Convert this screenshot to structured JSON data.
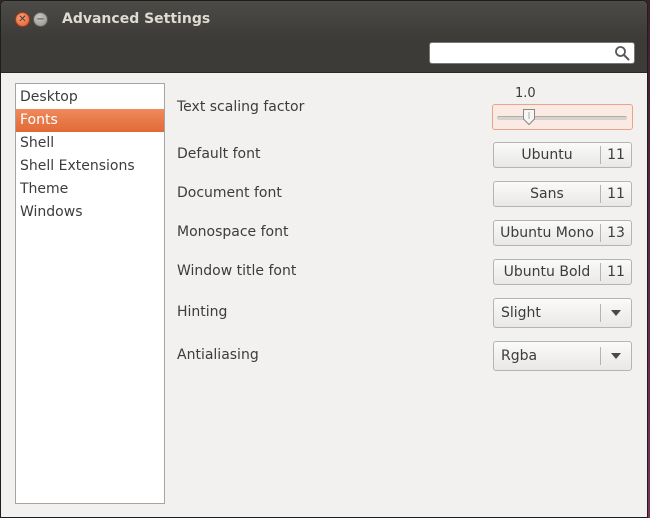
{
  "window": {
    "title": "Advanced Settings"
  },
  "icons": {
    "close": "close-icon",
    "minimize": "minimize-icon",
    "search": "search-icon",
    "dropdown": "chevron-down-icon"
  },
  "colors": {
    "accent": "#e06a36",
    "titlebar": "#3c3b37",
    "background": "#f2f1f0"
  },
  "search": {
    "value": "",
    "placeholder": ""
  },
  "sidebar": {
    "selected": "Fonts",
    "items": [
      {
        "label": "Desktop"
      },
      {
        "label": "Fonts"
      },
      {
        "label": "Shell"
      },
      {
        "label": "Shell Extensions"
      },
      {
        "label": "Theme"
      },
      {
        "label": "Windows"
      }
    ]
  },
  "settings": {
    "text_scaling": {
      "label": "Text scaling factor",
      "value": "1.0",
      "slider_fraction": 0.2
    },
    "default_font": {
      "label": "Default font",
      "font": "Ubuntu",
      "size": "11"
    },
    "document_font": {
      "label": "Document font",
      "font": "Sans",
      "size": "11"
    },
    "monospace_font": {
      "label": "Monospace font",
      "font": "Ubuntu Mono",
      "size": "13"
    },
    "window_title_font": {
      "label": "Window title font",
      "font": "Ubuntu Bold",
      "size": "11"
    },
    "hinting": {
      "label": "Hinting",
      "value": "Slight"
    },
    "antialiasing": {
      "label": "Antialiasing",
      "value": "Rgba"
    }
  }
}
